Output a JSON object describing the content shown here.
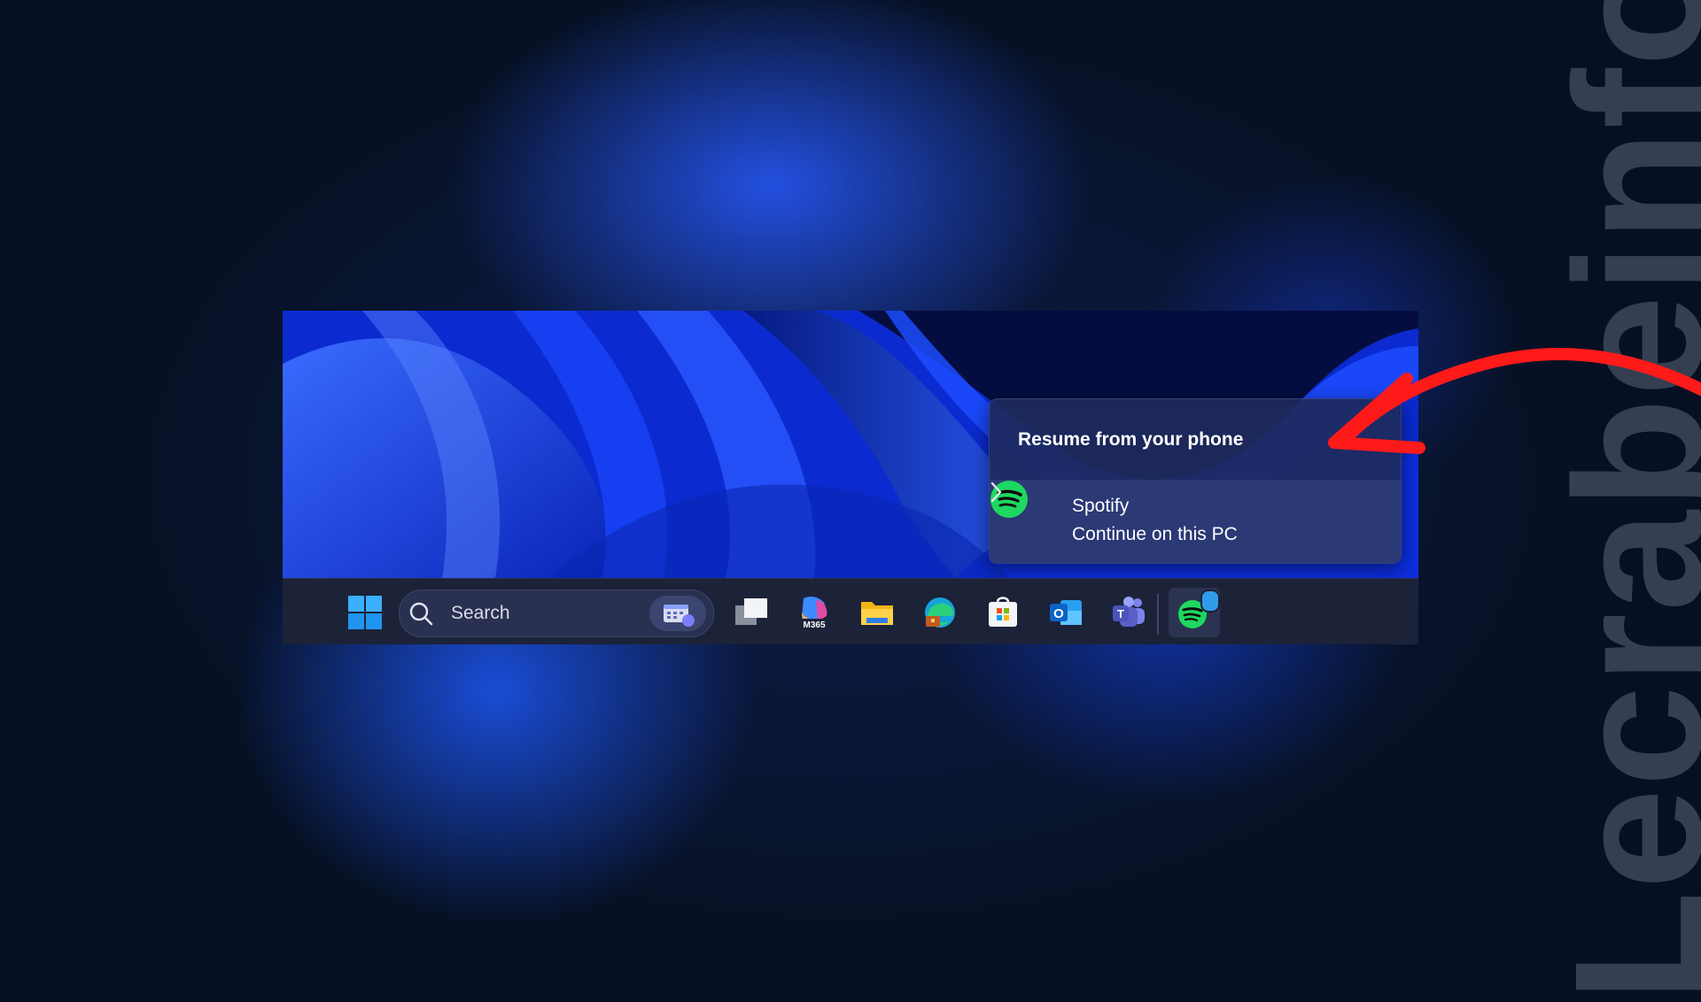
{
  "watermark": "Lecrabeinfo",
  "flyout": {
    "title": "Resume from your phone",
    "item": {
      "app_name": "Spotify",
      "action": "Continue on this PC",
      "icon": "spotify-icon"
    },
    "chevron_icon": "chevron-right-icon"
  },
  "taskbar": {
    "search_placeholder": "Search",
    "apps": [
      {
        "name": "start",
        "icon": "windows-logo-icon"
      },
      {
        "name": "task-view",
        "icon": "task-view-icon"
      },
      {
        "name": "microsoft-365",
        "icon": "m365-icon",
        "label": "M365"
      },
      {
        "name": "file-explorer",
        "icon": "folder-icon"
      },
      {
        "name": "edge",
        "icon": "edge-icon"
      },
      {
        "name": "microsoft-store",
        "icon": "store-icon"
      },
      {
        "name": "outlook",
        "icon": "outlook-icon",
        "label": "O"
      },
      {
        "name": "teams",
        "icon": "teams-icon",
        "label": "T"
      },
      {
        "name": "spotify-phone",
        "icon": "spotify-icon"
      }
    ]
  },
  "colors": {
    "accent_green": "#1ed760",
    "annotation_red": "#ff1a1a"
  }
}
